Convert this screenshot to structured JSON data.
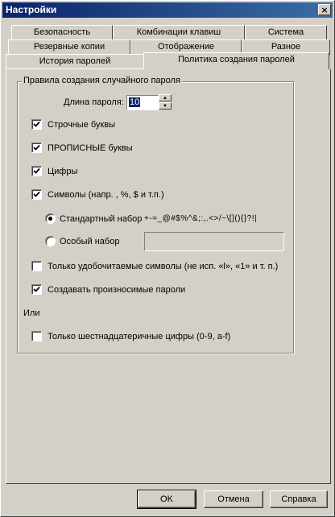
{
  "window": {
    "title": "Настройки",
    "close_glyph": "×"
  },
  "tabs": {
    "row1": [
      "Безопасность",
      "Комбинации клавиш",
      "Система"
    ],
    "row2": [
      "Резервные копии",
      "Отображение",
      "Разное"
    ],
    "row3": [
      "История паролей",
      "Политика создания паролей"
    ]
  },
  "group": {
    "title": "Правила создания случайного пароля",
    "length_label": "Длина пароля:",
    "length_value": "10",
    "lowercase": {
      "label": "Строчные буквы",
      "checked": true
    },
    "uppercase": {
      "label": "ПРОПИСНЫЕ буквы",
      "checked": true
    },
    "digits": {
      "label": "Цифры",
      "checked": true
    },
    "symbols": {
      "label": "Символы (напр. , %, $ и т.п.)",
      "checked": true
    },
    "standard_set": {
      "label": "Стандартный набор",
      "chars": "+-=_@#$%^&;:,.<>/~\\[](){}?!|",
      "selected": true
    },
    "custom_set": {
      "label": "Особый набор",
      "value": ""
    },
    "readable_only": {
      "label": "Только удобочитаемые символы (не исп. «l», «1» и т. п.)",
      "checked": false
    },
    "pronounceable": {
      "label": "Создавать произносимые пароли",
      "checked": true
    },
    "or_label": "Или",
    "hex_only": {
      "label": "Только шестнадцатеричные цифры (0-9, a-f)",
      "checked": false
    }
  },
  "buttons": {
    "ok": "OK",
    "cancel": "Отмена",
    "help": "Справка"
  }
}
